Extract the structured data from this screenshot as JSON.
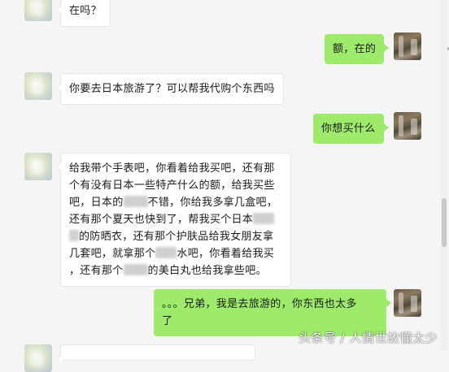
{
  "messages": [
    {
      "side": "left",
      "lines": [
        "在吗？"
      ]
    },
    {
      "side": "right",
      "lines": [
        "额，在的"
      ]
    },
    {
      "side": "left",
      "lines": [
        "你要去日本旅游了？可以帮我代购个东西吗"
      ]
    },
    {
      "side": "right",
      "lines": [
        "你想买什么"
      ]
    },
    {
      "side": "left",
      "lines": [
        "给我带个手表吧，你看着给我买吧，还有那",
        "个有没有日本一些特产什么的额，给我买些",
        [
          "吧，日本的",
          "不错，你给我多拿几盒吧，"
        ],
        [
          "还有那个夏天也快到了，帮我买个日本",
          ""
        ],
        [
          "",
          "的防晒衣，还有那个护肤品给我女朋友拿"
        ],
        [
          "几套吧，就拿那个",
          "水吧，你看着给我买"
        ],
        [
          "，还有那个",
          "的美白丸也给我拿些吧。"
        ]
      ]
    },
    {
      "side": "right",
      "lines": [
        "。。。兄弟，我是去旅游的，你东西也太多",
        "了"
      ]
    }
  ],
  "watermark": "头条号 / 人情世故懂太少",
  "colors": {
    "background": "#f5f5f5",
    "sent_bubble": "#9eea6a",
    "received_bubble": "#ffffff"
  }
}
